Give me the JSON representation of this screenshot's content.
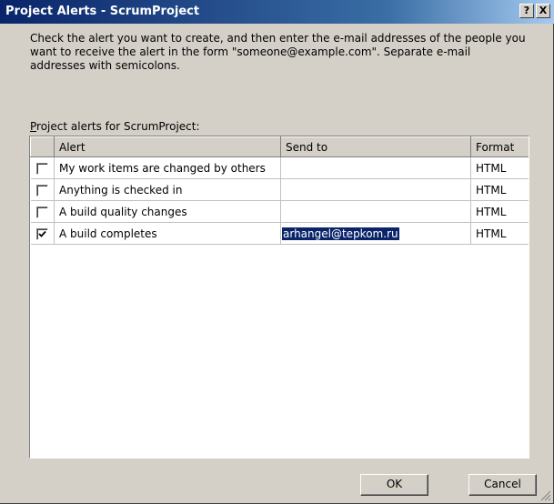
{
  "window": {
    "title": "Project Alerts - ScrumProject",
    "help_label": "?",
    "close_label": "X"
  },
  "instructions": "Check the alert you want to create, and then enter the e-mail addresses of the people you want to receive the alert in the form \"someone@example.com\". Separate e-mail addresses with semicolons.",
  "list_label": "Project alerts for ScrumProject:",
  "columns": {
    "alert": "Alert",
    "send_to": "Send to",
    "format": "Format"
  },
  "rows": [
    {
      "checked": false,
      "alert": "My work items are changed by others",
      "send_to": "",
      "format": "HTML"
    },
    {
      "checked": false,
      "alert": "Anything is checked in",
      "send_to": "",
      "format": "HTML"
    },
    {
      "checked": false,
      "alert": "A build quality changes",
      "send_to": "",
      "format": "HTML"
    },
    {
      "checked": true,
      "alert": "A build completes",
      "send_to": "arhangel@tepkom.ru",
      "format": "HTML"
    }
  ],
  "buttons": {
    "ok": "OK",
    "cancel": "Cancel"
  },
  "colors": {
    "title_bar": "#0a246a",
    "dialog_face": "#d4d0c8",
    "selection": "#0a246a"
  }
}
